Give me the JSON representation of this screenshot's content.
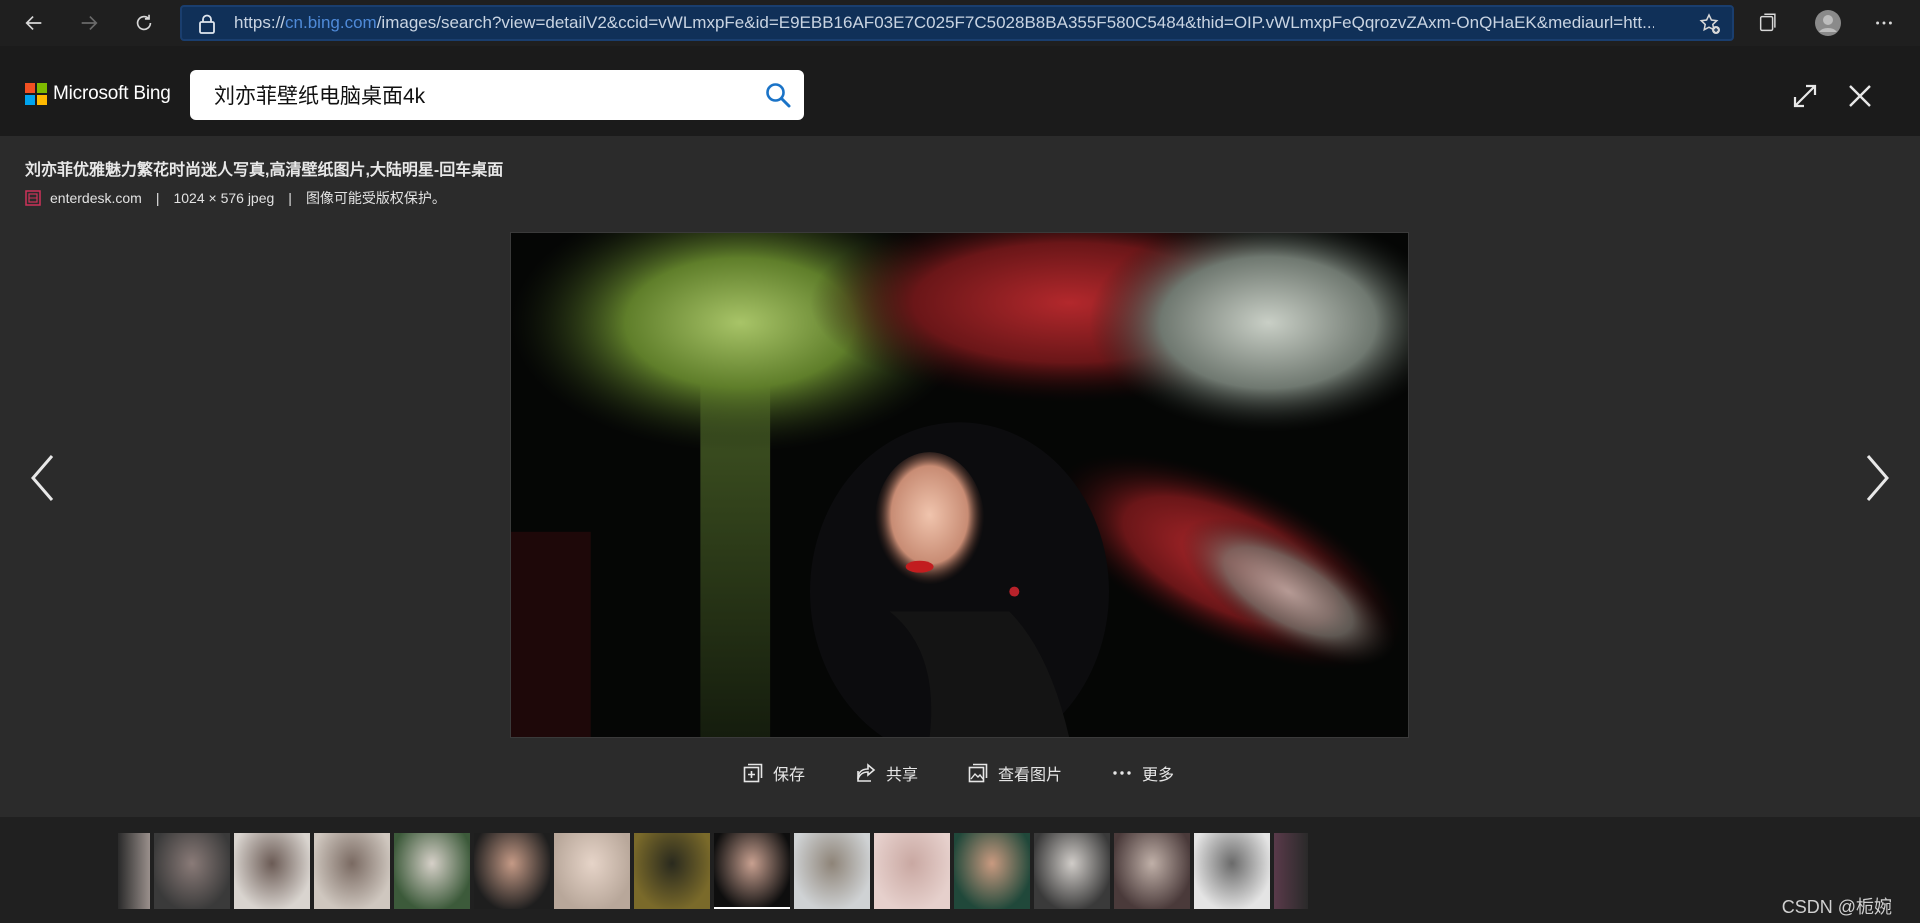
{
  "browser": {
    "url_prefix": "https://",
    "url_host": "cn.bing.com",
    "url_rest": "/images/search?view=detailV2&ccid=vWLmxpFe&id=E9EBB16AF03E7C025F7C5028B8BA355F580C5484&thid=OIP.vWLmxpFeQqrozvZAxm-OnQHaEK&mediaurl=htt..."
  },
  "header": {
    "logo_text": "Microsoft Bing",
    "search_value": "刘亦菲壁纸电脑桌面4k",
    "logo_colors": [
      "#f25022",
      "#7fba00",
      "#00a4ef",
      "#ffb900"
    ]
  },
  "detail": {
    "title": "刘亦菲优雅魅力繁花时尚迷人写真,高清壁纸图片,大陆明星-回车桌面",
    "source": "enterdesk.com",
    "separator": "|",
    "dimensions": "1024 × 576 jpeg",
    "copyright": "图像可能受版权保护。"
  },
  "actions": {
    "save": "保存",
    "share": "共享",
    "view_image": "查看图片",
    "more": "更多"
  },
  "filmstrip": {
    "selected_index": 7,
    "thumbnail_count": 14
  },
  "watermark": "CSDN @栀婉"
}
